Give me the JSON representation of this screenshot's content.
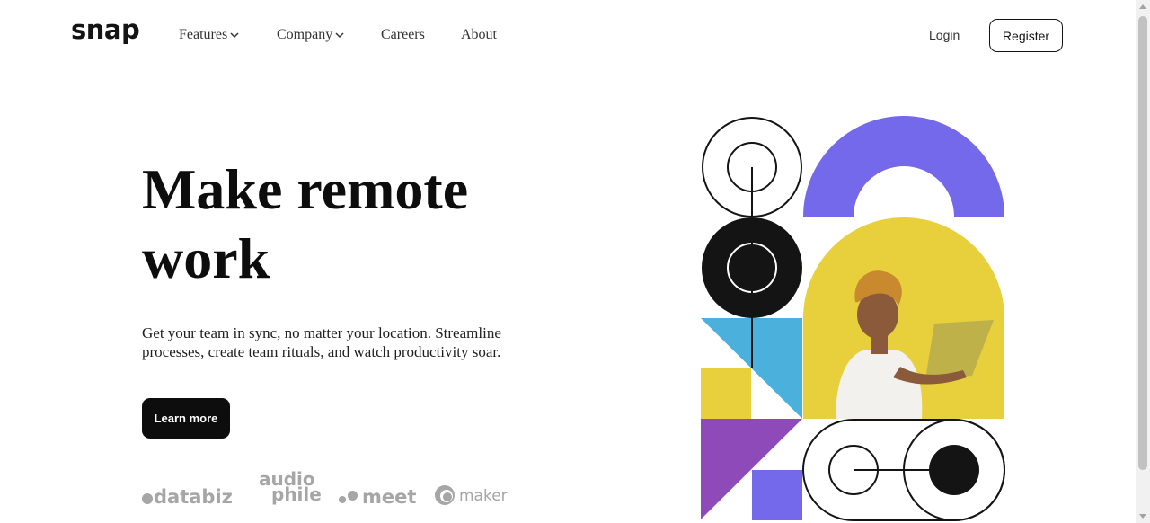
{
  "brand": {
    "logo": "snap"
  },
  "nav": {
    "items": [
      {
        "label": "Features",
        "dropdown": true
      },
      {
        "label": "Company",
        "dropdown": true
      },
      {
        "label": "Careers",
        "dropdown": false
      },
      {
        "label": "About",
        "dropdown": false
      }
    ],
    "login": "Login",
    "register": "Register"
  },
  "hero": {
    "title_line1": "Make remote",
    "title_line2": "work",
    "description": "Get your team in sync, no matter your location. Streamline processes, create team rituals, and watch productivity soar.",
    "cta": "Learn more"
  },
  "clients": {
    "databiz": "databiz",
    "audiophile_1": "audio",
    "audiophile_2": "phile",
    "meet": "meet",
    "maker": "maker"
  },
  "colors": {
    "purple": "#7469ea",
    "yellow": "#e8cf3c",
    "blue": "#4cb0dd",
    "violet": "#8d4ab8",
    "black": "#141414"
  }
}
